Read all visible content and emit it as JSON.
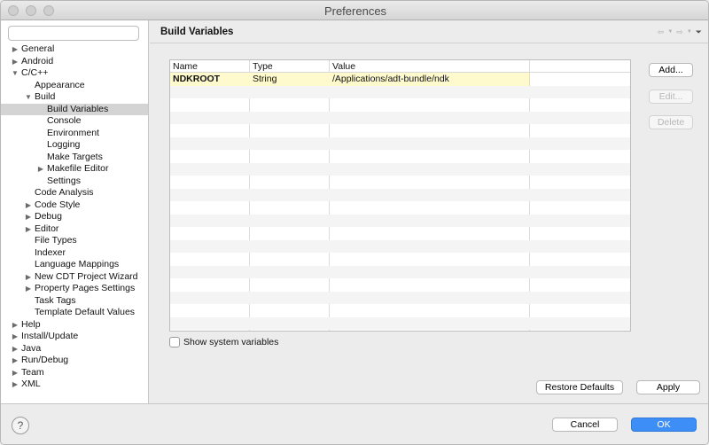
{
  "window": {
    "title": "Preferences"
  },
  "filter": {
    "placeholder": ""
  },
  "tree": [
    {
      "label": "General",
      "level": 0,
      "arrow": "right"
    },
    {
      "label": "Android",
      "level": 0,
      "arrow": "right"
    },
    {
      "label": "C/C++",
      "level": 0,
      "arrow": "down"
    },
    {
      "label": "Appearance",
      "level": 1,
      "arrow": ""
    },
    {
      "label": "Build",
      "level": 1,
      "arrow": "down"
    },
    {
      "label": "Build Variables",
      "level": 2,
      "arrow": "",
      "selected": true
    },
    {
      "label": "Console",
      "level": 2,
      "arrow": ""
    },
    {
      "label": "Environment",
      "level": 2,
      "arrow": ""
    },
    {
      "label": "Logging",
      "level": 2,
      "arrow": ""
    },
    {
      "label": "Make Targets",
      "level": 2,
      "arrow": ""
    },
    {
      "label": "Makefile Editor",
      "level": 2,
      "arrow": "right"
    },
    {
      "label": "Settings",
      "level": 2,
      "arrow": ""
    },
    {
      "label": "Code Analysis",
      "level": 1,
      "arrow": ""
    },
    {
      "label": "Code Style",
      "level": 1,
      "arrow": "right"
    },
    {
      "label": "Debug",
      "level": 1,
      "arrow": "right"
    },
    {
      "label": "Editor",
      "level": 1,
      "arrow": "right"
    },
    {
      "label": "File Types",
      "level": 1,
      "arrow": ""
    },
    {
      "label": "Indexer",
      "level": 1,
      "arrow": ""
    },
    {
      "label": "Language Mappings",
      "level": 1,
      "arrow": ""
    },
    {
      "label": "New CDT Project Wizard",
      "level": 1,
      "arrow": "right"
    },
    {
      "label": "Property Pages Settings",
      "level": 1,
      "arrow": "right"
    },
    {
      "label": "Task Tags",
      "level": 1,
      "arrow": ""
    },
    {
      "label": "Template Default Values",
      "level": 1,
      "arrow": ""
    },
    {
      "label": "Help",
      "level": 0,
      "arrow": "right"
    },
    {
      "label": "Install/Update",
      "level": 0,
      "arrow": "right"
    },
    {
      "label": "Java",
      "level": 0,
      "arrow": "right"
    },
    {
      "label": "Run/Debug",
      "level": 0,
      "arrow": "right"
    },
    {
      "label": "Team",
      "level": 0,
      "arrow": "right"
    },
    {
      "label": "XML",
      "level": 0,
      "arrow": "right"
    }
  ],
  "page": {
    "title": "Build Variables"
  },
  "table": {
    "headers": [
      "Name",
      "Type",
      "Value"
    ],
    "rows": [
      {
        "name": "NDKROOT",
        "type": "String",
        "value": "/Applications/adt-bundle/ndk"
      }
    ],
    "empty_row_count": 20
  },
  "buttons": {
    "add": "Add...",
    "edit": "Edit...",
    "delete": "Delete",
    "restore_defaults": "Restore Defaults",
    "apply": "Apply",
    "cancel": "Cancel",
    "ok": "OK"
  },
  "checkbox": {
    "label": "Show system variables",
    "checked": false
  },
  "icons": {
    "help": "?",
    "arrow_right": "▶",
    "arrow_down": "▼",
    "nav_back": "⇦",
    "nav_forward": "⇨",
    "view_menu": "⏷"
  },
  "colors": {
    "ok_button": "#3e8ef7",
    "selected_row": "#d4d4d4",
    "value_highlight": "#fffacd"
  }
}
